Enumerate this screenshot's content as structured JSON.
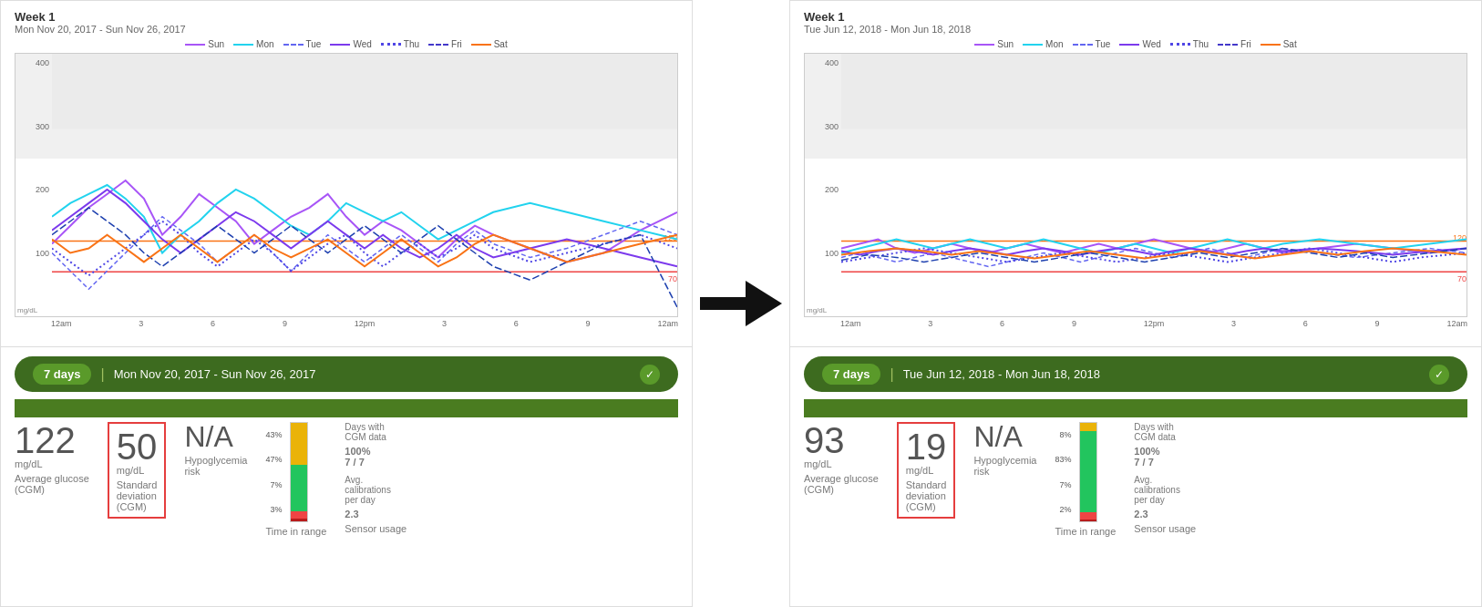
{
  "left_panel": {
    "title": "Week 1",
    "subtitle": "Mon Nov 20, 2017 - Sun Nov 26, 2017",
    "legend": {
      "days": [
        "Sun",
        "Mon",
        "Tue",
        "Wed",
        "Thu",
        "Fri",
        "Sat"
      ]
    },
    "chart": {
      "y_labels": [
        "400",
        "300",
        "200",
        "100",
        ""
      ],
      "x_labels": [
        "12am",
        "3",
        "6",
        "9",
        "12pm",
        "3",
        "6",
        "9",
        "12am"
      ],
      "ref_120": "120",
      "ref_70": "70",
      "mgdl": "mg/dL"
    },
    "date_bar": {
      "days": "7 days",
      "separator": "|",
      "range": "Mon Nov 20, 2017 - Sun Nov 26, 2017"
    },
    "metrics": {
      "avg_glucose": {
        "value": "122",
        "unit": "mg/dL",
        "label": "Average glucose\n(CGM)"
      },
      "std_dev": {
        "value": "50",
        "unit": "mg/dL",
        "label": "Standard\ndeviation\n(CGM)"
      },
      "hypo_risk": {
        "value": "N/A",
        "label": "Hypoglycemia\nrisk"
      },
      "time_in_range": {
        "label": "Time in range",
        "segments": [
          {
            "pct": 43,
            "color": "#eab308",
            "label": "43%"
          },
          {
            "pct": 47,
            "color": "#22c55e",
            "label": "47%"
          },
          {
            "pct": 7,
            "color": "#ef4444",
            "label": "7%"
          },
          {
            "pct": 3,
            "color": "#b91c1c",
            "label": "3%"
          }
        ]
      },
      "sensor_usage": {
        "label": "Sensor usage",
        "days_with_cgm_label": "Days with\nCGM data",
        "days_with_cgm_value": "100%\n7 / 7",
        "avg_cal_label": "Avg.\ncalibrations\nper day",
        "avg_cal_value": "2.3"
      }
    }
  },
  "right_panel": {
    "title": "Week 1",
    "subtitle": "Tue Jun 12, 2018 - Mon Jun 18, 2018",
    "legend": {
      "days": [
        "Sun",
        "Mon",
        "Tue",
        "Wed",
        "Thu",
        "Fri",
        "Sat"
      ]
    },
    "chart": {
      "y_labels": [
        "400",
        "300",
        "200",
        "100",
        ""
      ],
      "x_labels": [
        "12am",
        "3",
        "6",
        "9",
        "12pm",
        "3",
        "6",
        "9",
        "12am"
      ],
      "ref_120": "120",
      "ref_70": "70",
      "mgdl": "mg/dL"
    },
    "date_bar": {
      "days": "7 days",
      "separator": "|",
      "range": "Tue Jun 12, 2018 - Mon Jun 18, 2018"
    },
    "metrics": {
      "avg_glucose": {
        "value": "93",
        "unit": "mg/dL",
        "label": "Average glucose\n(CGM)"
      },
      "std_dev": {
        "value": "19",
        "unit": "mg/dL",
        "label": "Standard\ndeviation\n(CGM)"
      },
      "hypo_risk": {
        "value": "N/A",
        "label": "Hypoglycemia\nrisk"
      },
      "time_in_range": {
        "label": "Time in range",
        "segments": [
          {
            "pct": 8,
            "color": "#eab308",
            "label": "8%"
          },
          {
            "pct": 83,
            "color": "#22c55e",
            "label": "83%"
          },
          {
            "pct": 7,
            "color": "#ef4444",
            "label": "7%"
          },
          {
            "pct": 2,
            "color": "#b91c1c",
            "label": "2%"
          }
        ]
      },
      "sensor_usage": {
        "label": "Sensor usage",
        "days_with_cgm_label": "Days with\nCGM data",
        "days_with_cgm_value": "100%\n7 / 7",
        "avg_cal_label": "Avg.\ncalibrations\nper day",
        "avg_cal_value": "2.3"
      }
    }
  }
}
